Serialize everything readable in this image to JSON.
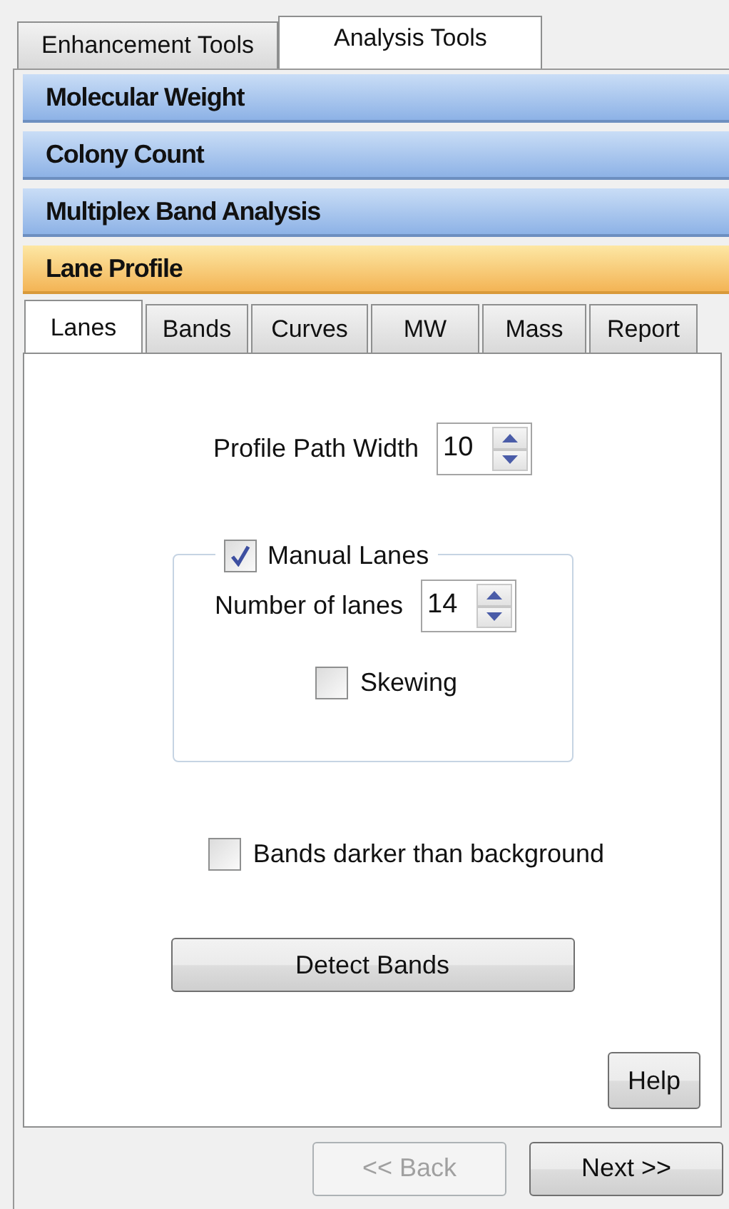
{
  "outer_tabs": [
    {
      "label": "Enhancement Tools",
      "selected": false
    },
    {
      "label": "Analysis Tools",
      "selected": true
    }
  ],
  "sections": [
    {
      "title": "Molecular Weight",
      "expanded": false
    },
    {
      "title": "Colony Count",
      "expanded": false
    },
    {
      "title": "Multiplex Band Analysis",
      "expanded": false
    },
    {
      "title": "Lane Profile",
      "expanded": true
    }
  ],
  "inner_tabs": [
    {
      "label": "Lanes",
      "selected": true
    },
    {
      "label": "Bands",
      "selected": false
    },
    {
      "label": "Curves",
      "selected": false
    },
    {
      "label": "MW",
      "selected": false
    },
    {
      "label": "Mass",
      "selected": false
    },
    {
      "label": "Report",
      "selected": false
    }
  ],
  "profile_path_width": {
    "label": "Profile Path Width",
    "value": "10"
  },
  "manual_lanes": {
    "label": "Manual Lanes",
    "checked": true,
    "number_of_lanes": {
      "label": "Number of lanes",
      "value": "14"
    },
    "skewing": {
      "label": "Skewing",
      "checked": false
    }
  },
  "bands_darker": {
    "label": "Bands darker than background",
    "checked": false
  },
  "detect_button": "Detect Bands",
  "help_button": "Help",
  "nav_buttons": [
    {
      "label": "<< Back",
      "disabled": true
    },
    {
      "label": "Next >>",
      "disabled": false
    }
  ]
}
